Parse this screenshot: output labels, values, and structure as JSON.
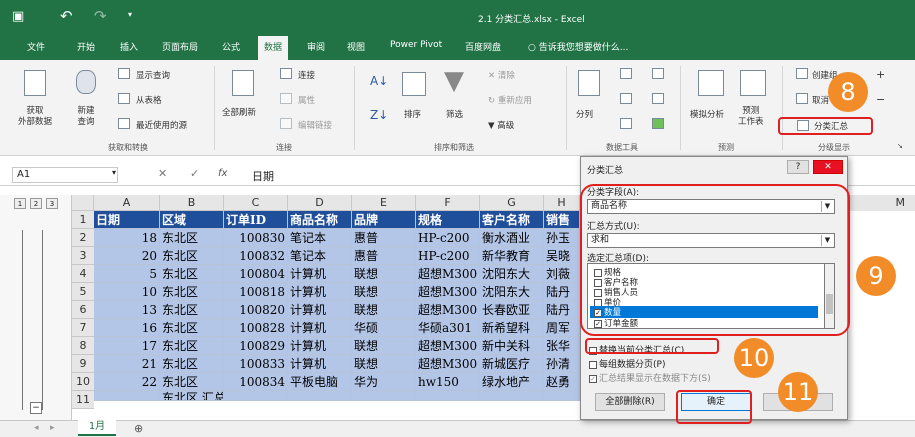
{
  "window": {
    "title": "2.1 分类汇总.xlsx - Excel"
  },
  "tabs": [
    "文件",
    "开始",
    "插入",
    "页面布局",
    "公式",
    "数据",
    "审阅",
    "视图",
    "Power Pivot",
    "百度网盘"
  ],
  "active_tab": "数据",
  "tell_me": "告诉我您想要做什么...",
  "ribbon": {
    "get_external": "获取\n外部数据",
    "new_query": "新建\n查询",
    "show_queries": "显示查询",
    "from_table": "从表格",
    "recent_sources": "最近使用的源",
    "group_get_transform": "获取和转换",
    "refresh_all": "全部刷新",
    "connections": "连接",
    "properties": "属性",
    "edit_links": "编辑链接",
    "group_connections": "连接",
    "sort": "排序",
    "filter": "筛选",
    "clear": "清除",
    "reapply": "重新应用",
    "advanced": "高级",
    "group_sort_filter": "排序和筛选",
    "text_to_columns": "分列",
    "group_data_tools": "数据工具",
    "what_if": "模拟分析",
    "forecast_sheet": "预测\n工作表",
    "group_forecast": "预测",
    "group_outline": "创建组",
    "ungroup": "取消",
    "subtotal": "分类汇总",
    "group_outline_label": "分级显示"
  },
  "formula_bar": {
    "name_box": "A1",
    "fx": "fx",
    "content": "日期"
  },
  "columns": [
    "A",
    "B",
    "C",
    "D",
    "E",
    "F",
    "G",
    "H"
  ],
  "extra_col": "M",
  "outline_levels": [
    "1",
    "2",
    "3"
  ],
  "rows": [
    {
      "num": "1",
      "cells": [
        "日期",
        "区域",
        "订单ID",
        "商品名称",
        "品牌",
        "规格",
        "客户名称",
        "销售"
      ]
    },
    {
      "num": "2",
      "cells": [
        "18",
        "东北区",
        "100830",
        "笔记本",
        "惠普",
        "HP-c200",
        "衡水酒业",
        "孙玉"
      ]
    },
    {
      "num": "3",
      "cells": [
        "20",
        "东北区",
        "100832",
        "笔记本",
        "惠普",
        "HP-c200",
        "新华教育",
        "吴晓"
      ]
    },
    {
      "num": "4",
      "cells": [
        "5",
        "东北区",
        "100804",
        "计算机",
        "联想",
        "超想M300",
        "沈阳东大",
        "刘薇"
      ]
    },
    {
      "num": "5",
      "cells": [
        "10",
        "东北区",
        "100818",
        "计算机",
        "联想",
        "超想M300",
        "沈阳东大",
        "陆丹"
      ]
    },
    {
      "num": "6",
      "cells": [
        "13",
        "东北区",
        "100820",
        "计算机",
        "联想",
        "超想M300",
        "长春欧亚",
        "陆丹"
      ]
    },
    {
      "num": "7",
      "cells": [
        "16",
        "东北区",
        "100828",
        "计算机",
        "华硕",
        "华硕a301",
        "新希望科",
        "周军"
      ]
    },
    {
      "num": "8",
      "cells": [
        "17",
        "东北区",
        "100829",
        "计算机",
        "联想",
        "超想M300",
        "新中关科",
        "张华"
      ]
    },
    {
      "num": "9",
      "cells": [
        "21",
        "东北区",
        "100833",
        "计算机",
        "联想",
        "超想M300",
        "新城医疗",
        "孙清"
      ]
    },
    {
      "num": "10",
      "cells": [
        "22",
        "东北区",
        "100834",
        "平板电脑",
        "华为",
        "hw150",
        "绿水地产",
        "赵勇"
      ]
    },
    {
      "num": "11",
      "cells": [
        "",
        "东北区 汇总",
        "",
        "",
        "",
        "",
        "",
        ""
      ]
    }
  ],
  "sheet_tab": "1月",
  "dialog": {
    "title": "分类汇总",
    "help": "?",
    "close": "✕",
    "field_label": "分类字段(A):",
    "field_value": "商品名称",
    "method_label": "汇总方式(U):",
    "method_value": "求和",
    "items_label": "选定汇总项(D):",
    "items": [
      {
        "label": "规格",
        "checked": false
      },
      {
        "label": "客户名称",
        "checked": false
      },
      {
        "label": "销售人员",
        "checked": false
      },
      {
        "label": "单价",
        "checked": false
      },
      {
        "label": "数量",
        "checked": true
      },
      {
        "label": "订单金额",
        "checked": true
      }
    ],
    "replace_label": "替换当前分类汇总(C)",
    "pagebreak_label": "每组数据分页(P)",
    "below_label": "汇总结果显示在数据下方(S)",
    "remove_all": "全部删除(R)",
    "ok": "确定",
    "cancel": "取消"
  },
  "badges": [
    "8",
    "9",
    "10",
    "11"
  ],
  "colors": {
    "excel_green": "#217346",
    "badge": "#f28c28",
    "highlight": "#e02020",
    "header_fill": "#1f4e9a",
    "cell_fill": "#b4c6e7"
  }
}
